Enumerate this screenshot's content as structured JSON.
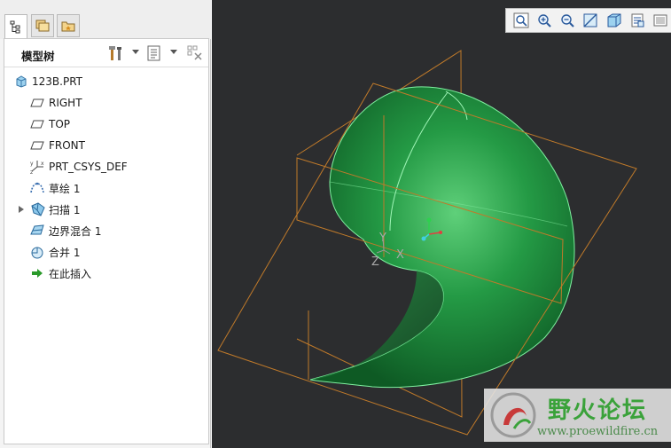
{
  "tabs": [
    {
      "icon": "model-tree-icon",
      "active": true
    },
    {
      "icon": "folder-browser-icon",
      "active": false
    },
    {
      "icon": "favorites-icon",
      "active": false
    }
  ],
  "tree": {
    "title": "模型树",
    "items": [
      {
        "label": "123B.PRT",
        "icon": "part-icon"
      },
      {
        "label": "RIGHT",
        "icon": "datum-plane-icon"
      },
      {
        "label": "TOP",
        "icon": "datum-plane-icon"
      },
      {
        "label": "FRONT",
        "icon": "datum-plane-icon"
      },
      {
        "label": "PRT_CSYS_DEF",
        "icon": "coordinate-system-icon"
      },
      {
        "label": "草绘 1",
        "icon": "sketch-icon"
      },
      {
        "label": "扫描 1",
        "icon": "sweep-icon",
        "expandable": true
      },
      {
        "label": "边界混合 1",
        "icon": "boundary-blend-icon"
      },
      {
        "label": "合并 1",
        "icon": "merge-icon"
      },
      {
        "label": "在此插入",
        "icon": "insert-here-icon"
      }
    ]
  },
  "view_toolbar": [
    "refit-icon",
    "zoom-in-icon",
    "zoom-out-icon",
    "repaint-icon",
    "display-style-icon",
    "saved-views-icon",
    "more-icon"
  ],
  "triad": {
    "x": "X",
    "y": "Y",
    "z": "Z"
  },
  "watermark": {
    "title": "野火论坛",
    "url": "www.proewildfire.cn"
  },
  "colors": {
    "viewport_bg": "#2c2d2f",
    "surface": "#1f8a3e",
    "datum": "#c07a2a"
  }
}
